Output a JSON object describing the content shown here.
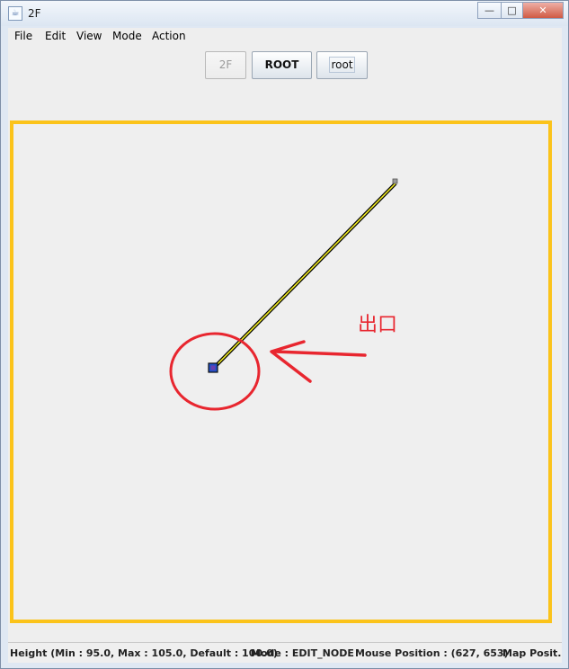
{
  "window": {
    "title": "2F",
    "controls": {
      "minimize": "—",
      "maximize": "□",
      "close": "✕"
    }
  },
  "menu": {
    "items": [
      "File",
      "Edit",
      "View",
      "Mode",
      "Action"
    ]
  },
  "toolbar": {
    "floor_button": "2F",
    "root_upper_button": "ROOT",
    "root_lower_button": "root"
  },
  "canvas": {
    "border_color": "#fbc31a",
    "annotation_label": "出口",
    "annotation_color": "#e8262f",
    "path_color": "#f2ec22"
  },
  "status": {
    "height": "Height (Min : 95.0, Max : 105.0, Default : 100.0)",
    "mode": "Mode : EDIT_NODE",
    "mouse_position": "Mouse Position : (627, 653)",
    "map_position": "Map Posit..."
  },
  "colors": {
    "accent": "#fbc31a",
    "annotation": "#e8262f",
    "node": "#2050c8"
  }
}
